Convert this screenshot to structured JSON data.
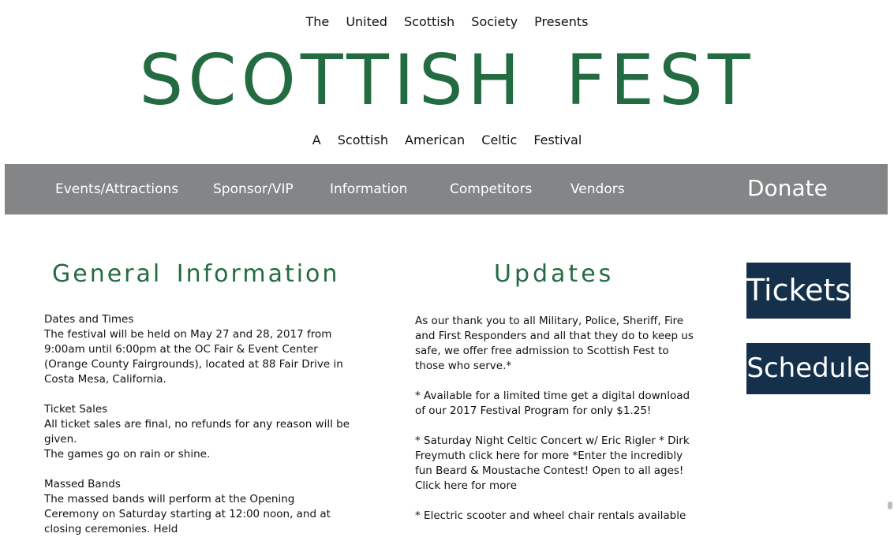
{
  "header": {
    "presenter_line": "The United Scottish Society Presents",
    "title": "SCOTTISH FEST",
    "tagline": "A Scottish American Celtic Festival"
  },
  "nav": {
    "items": [
      {
        "label": "Events/Attractions"
      },
      {
        "label": "Sponsor/VIP"
      },
      {
        "label": "Information"
      },
      {
        "label": "Competitors"
      },
      {
        "label": "Vendors"
      }
    ],
    "donate": "Donate"
  },
  "general": {
    "heading": "General Information",
    "dates_heading": "Dates and Times",
    "dates_text_1": "The festival will be held on May 27 and 28, 2017 from 9:00am until 6:00pm at the OC Fair & Event Center",
    "dates_text_2": "(Orange County Fairgrounds), located at 88 Fair Drive in Costa Mesa, California.",
    "ticket_heading": "Ticket Sales",
    "ticket_text_1": "All ticket sales are final, no refunds for any reason will be given.",
    "ticket_text_2": "The games go on rain or shine.",
    "bands_heading": "Massed Bands",
    "bands_text": "The massed bands will perform at the Opening Ceremony on Saturday starting at 12:00 noon, and at closing ceremonies. Held"
  },
  "updates": {
    "heading": "Updates",
    "item_1": "As our thank you to all Military, Police, Sheriff, Fire and First Responders and all that they do to keep us safe, we offer free admission to Scottish Fest to those who serve.*",
    "item_2": "* Available for a limited time get a digital download of our 2017 Festival Program for only $1.25!",
    "item_3": "* Saturday Night Celtic Concert w/ Eric Rigler * Dirk Freymuth click here for more *Enter the incredibly fun Beard & Moustache Contest! Open to all ages! Click here for more",
    "item_4": "* Electric scooter and wheel chair rentals available"
  },
  "buttons": {
    "tickets": "Tickets",
    "schedule": "Schedule"
  },
  "colors": {
    "brand_green": "#236b41",
    "nav_gray": "#848586",
    "button_navy": "#14304a"
  }
}
